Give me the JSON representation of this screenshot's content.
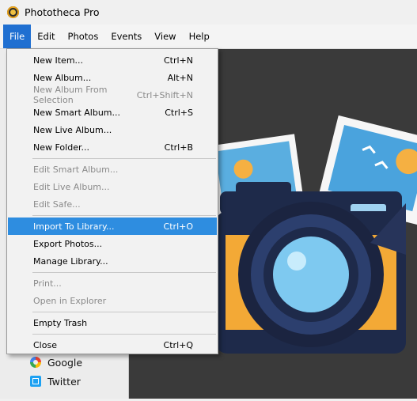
{
  "window": {
    "title": "Phototheca Pro"
  },
  "menubar": {
    "items": [
      "File",
      "Edit",
      "Photos",
      "Events",
      "View",
      "Help"
    ]
  },
  "file_menu": {
    "items": [
      {
        "label": "New Item...",
        "shortcut": "Ctrl+N",
        "enabled": true
      },
      {
        "label": "New Album...",
        "shortcut": "Alt+N",
        "enabled": true
      },
      {
        "label": "New Album From Selection",
        "shortcut": "Ctrl+Shift+N",
        "enabled": false
      },
      {
        "label": "New Smart Album...",
        "shortcut": "Ctrl+S",
        "enabled": true
      },
      {
        "label": "New Live Album...",
        "shortcut": "",
        "enabled": true
      },
      {
        "label": "New Folder...",
        "shortcut": "Ctrl+B",
        "enabled": true
      },
      {
        "label": "Edit Smart Album...",
        "shortcut": "",
        "enabled": false
      },
      {
        "label": "Edit Live Album...",
        "shortcut": "",
        "enabled": false
      },
      {
        "label": "Edit Safe...",
        "shortcut": "",
        "enabled": false
      },
      {
        "label": "Import To Library...",
        "shortcut": "Ctrl+O",
        "enabled": true,
        "highlighted": true
      },
      {
        "label": "Export Photos...",
        "shortcut": "",
        "enabled": true
      },
      {
        "label": "Manage Library...",
        "shortcut": "",
        "enabled": true
      },
      {
        "label": "Print...",
        "shortcut": "",
        "enabled": false
      },
      {
        "label": "Open in Explorer",
        "shortcut": "",
        "enabled": false
      },
      {
        "label": "Empty Trash",
        "shortcut": "",
        "enabled": true
      },
      {
        "label": "Close",
        "shortcut": "Ctrl+Q",
        "enabled": true
      }
    ]
  },
  "sidebar": {
    "sources": [
      {
        "label": "Google",
        "icon": "google-icon"
      },
      {
        "label": "Twitter",
        "icon": "twitter-icon"
      }
    ]
  },
  "colors": {
    "menu_highlight": "#2e8de0",
    "active_menu": "#1f6fd1",
    "canvas_bg": "#3a3a3a"
  }
}
